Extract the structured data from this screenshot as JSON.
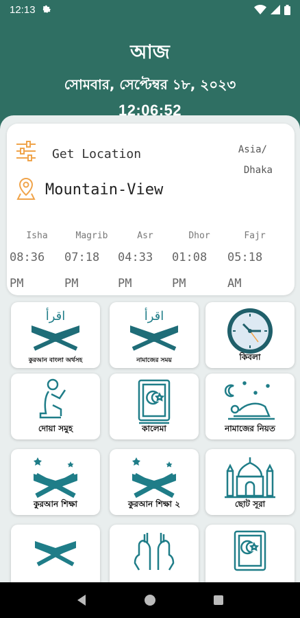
{
  "status": {
    "time": "12:13"
  },
  "header": {
    "title": "আজ",
    "date": "সোমবার, সেপ্টেম্বর ১৮, ২০২৩",
    "clock": "12:06:52"
  },
  "location": {
    "get_location_label": "Get Location",
    "city": "Mountain-View",
    "timezone_line1": "Asia/",
    "timezone_line2": "Dhaka"
  },
  "prayers": [
    {
      "name": "Isha",
      "time": "08:36",
      "ampm": "PM"
    },
    {
      "name": "Magrib",
      "time": "07:18",
      "ampm": "PM"
    },
    {
      "name": "Asr",
      "time": "04:33",
      "ampm": "PM"
    },
    {
      "name": "Dhor",
      "time": "01:08",
      "ampm": "PM"
    },
    {
      "name": "Fajr",
      "time": "05:18",
      "ampm": "AM"
    }
  ],
  "tiles": [
    {
      "label": "কুরআন বাংলা অর্থসহ",
      "icon": "quran-book-icon"
    },
    {
      "label": "নামাজের সময়",
      "icon": "quran-book-icon"
    },
    {
      "label": "কিবলা",
      "icon": "clock-icon"
    },
    {
      "label": "দোয়া সমুহ",
      "icon": "praying-person-icon"
    },
    {
      "label": "কালেমা",
      "icon": "islamic-book-icon"
    },
    {
      "label": "নামাজের নিয়ত",
      "icon": "prostrating-person-icon"
    },
    {
      "label": "কুরআন শিক্ষা",
      "icon": "open-quran-icon"
    },
    {
      "label": "কুরআন শিক্ষা ২",
      "icon": "open-quran-icon"
    },
    {
      "label": "ছোট সূরা",
      "icon": "mosque-icon"
    },
    {
      "label": "",
      "icon": "open-quran-icon"
    },
    {
      "label": "",
      "icon": "praying-hands-icon"
    },
    {
      "label": "",
      "icon": "islamic-book-icon"
    }
  ],
  "colors": {
    "primary": "#2f6f63",
    "icon_teal": "#1f7d88",
    "accent_orange": "#f0a44b"
  }
}
